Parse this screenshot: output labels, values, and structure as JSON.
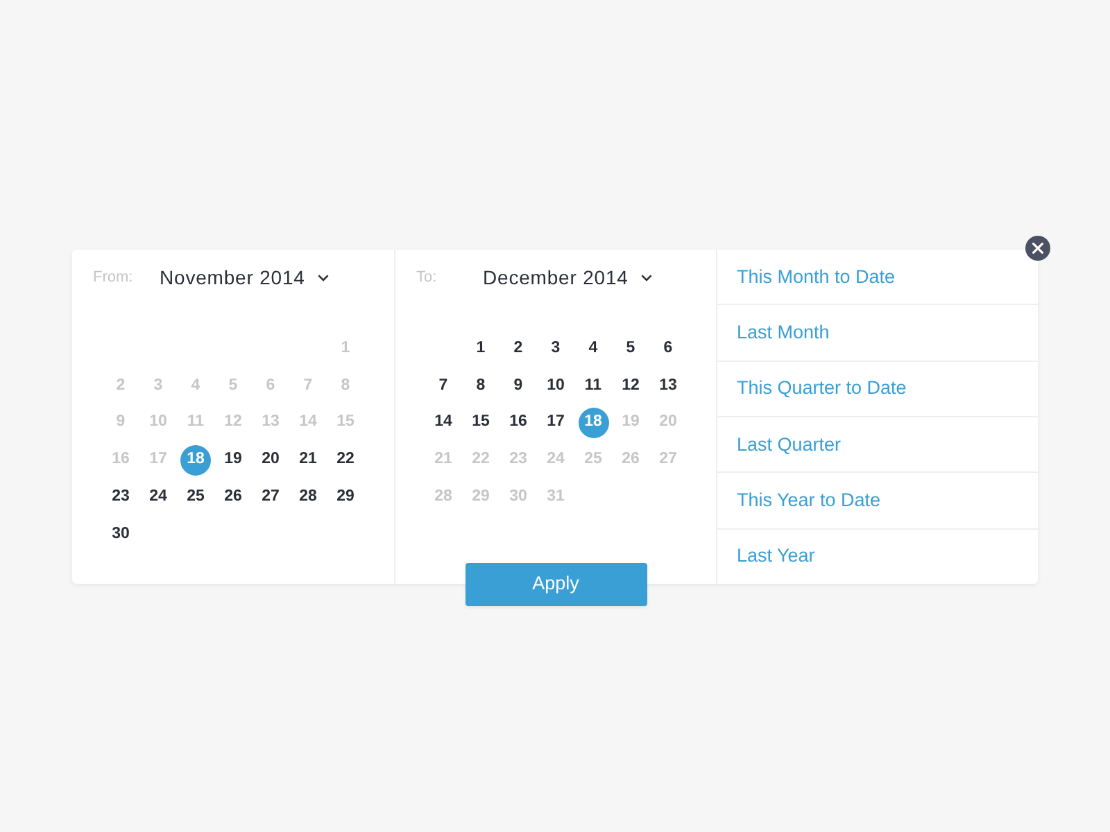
{
  "calendars": [
    {
      "label": "From:",
      "month": "November 2014",
      "weeks": [
        [
          {
            "day": "1",
            "in_range": false,
            "selected": false
          }
        ],
        [
          {
            "day": "2",
            "in_range": false,
            "selected": false
          },
          {
            "day": "3",
            "in_range": false,
            "selected": false
          },
          {
            "day": "4",
            "in_range": false,
            "selected": false
          },
          {
            "day": "5",
            "in_range": false,
            "selected": false
          },
          {
            "day": "6",
            "in_range": false,
            "selected": false
          },
          {
            "day": "7",
            "in_range": false,
            "selected": false
          },
          {
            "day": "8",
            "in_range": false,
            "selected": false
          }
        ],
        [
          {
            "day": "9",
            "in_range": false,
            "selected": false
          },
          {
            "day": "10",
            "in_range": false,
            "selected": false
          },
          {
            "day": "11",
            "in_range": false,
            "selected": false
          },
          {
            "day": "12",
            "in_range": false,
            "selected": false
          },
          {
            "day": "13",
            "in_range": false,
            "selected": false
          },
          {
            "day": "14",
            "in_range": false,
            "selected": false
          },
          {
            "day": "15",
            "in_range": false,
            "selected": false
          }
        ],
        [
          {
            "day": "16",
            "in_range": false,
            "selected": false
          },
          {
            "day": "17",
            "in_range": false,
            "selected": false
          },
          {
            "day": "18",
            "in_range": true,
            "selected": true
          },
          {
            "day": "19",
            "in_range": true,
            "selected": false
          },
          {
            "day": "20",
            "in_range": true,
            "selected": false
          },
          {
            "day": "21",
            "in_range": true,
            "selected": false
          },
          {
            "day": "22",
            "in_range": true,
            "selected": false
          }
        ],
        [
          {
            "day": "23",
            "in_range": true,
            "selected": false
          },
          {
            "day": "24",
            "in_range": true,
            "selected": false
          },
          {
            "day": "25",
            "in_range": true,
            "selected": false
          },
          {
            "day": "26",
            "in_range": true,
            "selected": false
          },
          {
            "day": "27",
            "in_range": true,
            "selected": false
          },
          {
            "day": "28",
            "in_range": true,
            "selected": false
          },
          {
            "day": "29",
            "in_range": true,
            "selected": false
          }
        ],
        [
          {
            "day": "30",
            "in_range": true,
            "selected": false
          }
        ]
      ]
    },
    {
      "label": "To:",
      "month": "December 2014",
      "weeks": [
        [
          {
            "day": "1",
            "in_range": true,
            "selected": false
          },
          {
            "day": "2",
            "in_range": true,
            "selected": false
          },
          {
            "day": "3",
            "in_range": true,
            "selected": false
          },
          {
            "day": "4",
            "in_range": true,
            "selected": false
          },
          {
            "day": "5",
            "in_range": true,
            "selected": false
          },
          {
            "day": "6",
            "in_range": true,
            "selected": false
          }
        ],
        [
          {
            "day": "7",
            "in_range": true,
            "selected": false
          },
          {
            "day": "8",
            "in_range": true,
            "selected": false
          },
          {
            "day": "9",
            "in_range": true,
            "selected": false
          },
          {
            "day": "10",
            "in_range": true,
            "selected": false
          },
          {
            "day": "11",
            "in_range": true,
            "selected": false
          },
          {
            "day": "12",
            "in_range": true,
            "selected": false
          },
          {
            "day": "13",
            "in_range": true,
            "selected": false
          }
        ],
        [
          {
            "day": "14",
            "in_range": true,
            "selected": false
          },
          {
            "day": "15",
            "in_range": true,
            "selected": false
          },
          {
            "day": "16",
            "in_range": true,
            "selected": false
          },
          {
            "day": "17",
            "in_range": true,
            "selected": false
          },
          {
            "day": "18",
            "in_range": true,
            "selected": true
          },
          {
            "day": "19",
            "in_range": false,
            "selected": false
          },
          {
            "day": "20",
            "in_range": false,
            "selected": false
          }
        ],
        [
          {
            "day": "21",
            "in_range": false,
            "selected": false
          },
          {
            "day": "22",
            "in_range": false,
            "selected": false
          },
          {
            "day": "23",
            "in_range": false,
            "selected": false
          },
          {
            "day": "24",
            "in_range": false,
            "selected": false
          },
          {
            "day": "25",
            "in_range": false,
            "selected": false
          },
          {
            "day": "26",
            "in_range": false,
            "selected": false
          },
          {
            "day": "27",
            "in_range": false,
            "selected": false
          }
        ],
        [
          {
            "day": "28",
            "in_range": false,
            "selected": false
          },
          {
            "day": "29",
            "in_range": false,
            "selected": false
          },
          {
            "day": "30",
            "in_range": false,
            "selected": false
          },
          {
            "day": "31",
            "in_range": false,
            "selected": false
          }
        ]
      ]
    }
  ],
  "apply_button": {
    "label": "Apply"
  },
  "presets": [
    {
      "label": "This Month to Date",
      "selected": false
    },
    {
      "label": "Last Month",
      "selected": false
    },
    {
      "label": "This Quarter to Date",
      "selected": false
    },
    {
      "label": "Last Quarter",
      "selected": false
    },
    {
      "label": "This Year to Date",
      "selected": false
    },
    {
      "label": "Last Year",
      "selected": false
    }
  ]
}
